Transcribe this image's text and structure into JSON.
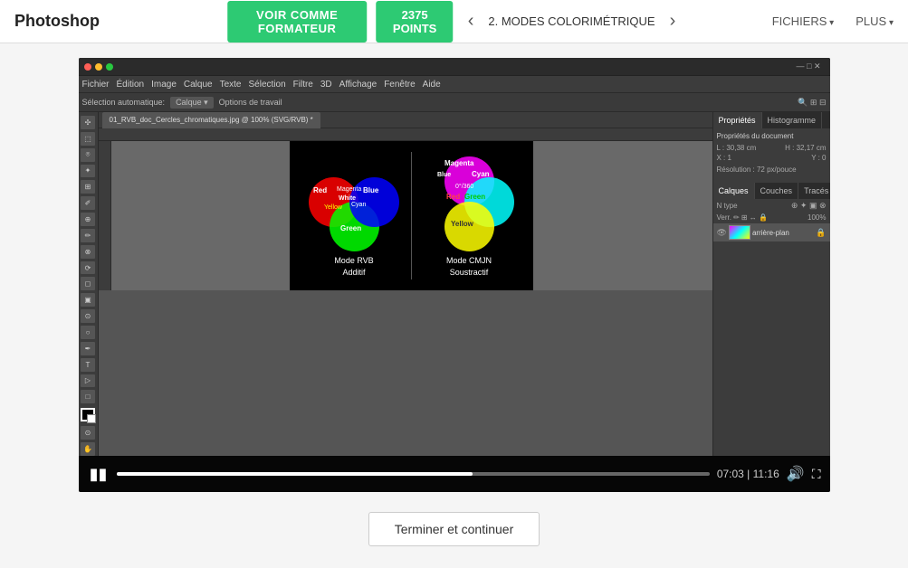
{
  "header": {
    "logo": "Photoshop",
    "btn_formateur": "VOIR COMME FORMATEUR",
    "btn_points": "2375 POINTS",
    "chapter": "2. MODES COLORIMÉTRIQUE",
    "nav_fichiers": "FICHIERS",
    "nav_plus": "PLUS"
  },
  "photoshop": {
    "titlebar_title": "",
    "menubar": [
      "Fichier",
      "Édition",
      "Image",
      "Calque",
      "Texte",
      "Sélection",
      "Filtre",
      "3D",
      "Affichage",
      "Fenêtre",
      "Aide"
    ],
    "toolbar_items": [
      "Sélection automatique:",
      "Calque ▾",
      "Options de travail"
    ],
    "file_tab": "01_RVB_doc_Cercles_chromatiques.jpg @ 100% (SVG/RVB) *",
    "panel_tabs_1": [
      "Propriétés",
      "Histogramme"
    ],
    "panel_content": {
      "row1_label": "L : 30,38 cm",
      "row1_value": "H : 32,17 cm",
      "row2_label": "X : 1",
      "row2_value": "Y : 0",
      "row3": "Résolution : 72 px/pouce"
    },
    "panel_tabs_2": [
      "Calques",
      "Couches",
      "Tracés"
    ],
    "layer_name": "arrière-plan"
  },
  "canvas": {
    "left_label": "Mode RVB\nAdditif",
    "right_label": "Mode CMJN\nSoustractif"
  },
  "video_controls": {
    "time": "07:03 | 11:16",
    "progress_pct": 60
  },
  "bottom": {
    "btn_terminer": "Terminer et continuer"
  }
}
